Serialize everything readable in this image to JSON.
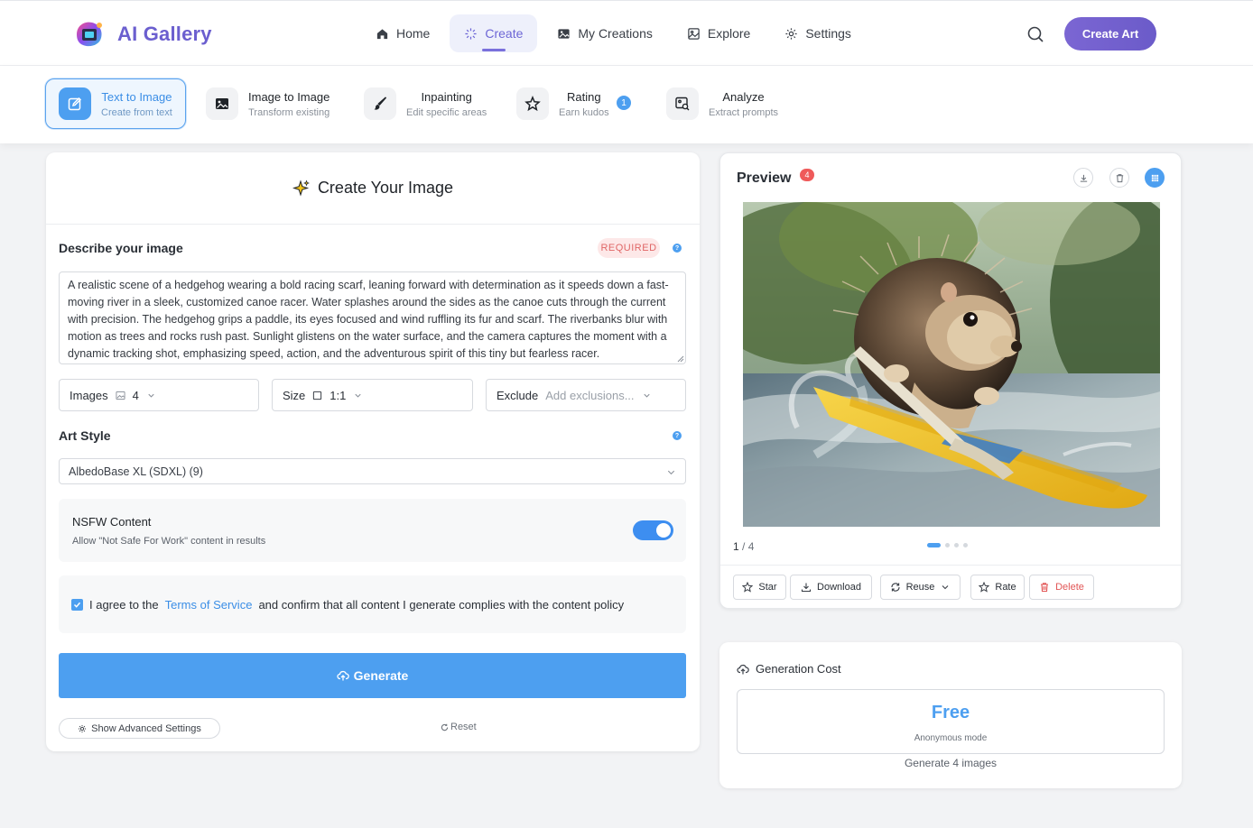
{
  "app": {
    "name": "AI Gallery"
  },
  "nav": {
    "items": [
      {
        "label": "Home",
        "icon": "home-icon"
      },
      {
        "label": "Create",
        "icon": "sparkle-icon",
        "active": true
      },
      {
        "label": "My Creations",
        "icon": "image-icon"
      },
      {
        "label": "Explore",
        "icon": "picture-icon"
      },
      {
        "label": "Settings",
        "icon": "gear-icon"
      }
    ],
    "cta": "Create Art"
  },
  "modes": [
    {
      "title": "Text to Image",
      "subtitle": "Create from text",
      "active": true
    },
    {
      "title": "Image to Image",
      "subtitle": "Transform existing"
    },
    {
      "title": "Inpainting",
      "subtitle": "Edit specific areas"
    },
    {
      "title": "Rating",
      "subtitle": "Earn kudos",
      "badge": "1"
    },
    {
      "title": "Analyze",
      "subtitle": "Extract prompts"
    }
  ],
  "form": {
    "title": "Create Your Image",
    "prompt_label": "Describe your image",
    "required": "REQUIRED",
    "prompt": "A realistic scene of a hedgehog wearing a bold racing scarf, leaning forward with determination as it speeds down a fast-moving river in a sleek, customized canoe racer. Water splashes around the sides as the canoe cuts through the current with precision. The hedgehog grips a paddle, its eyes focused and wind ruffling its fur and scarf. The riverbanks blur with motion as trees and rocks rush past. Sunlight glistens on the water surface, and the camera captures the moment with a dynamic tracking shot, emphasizing speed, action, and the adventurous spirit of this tiny but fearless racer.",
    "images_label": "Images",
    "images_value": "4",
    "size_label": "Size",
    "size_value": "1:1",
    "exclude_label": "Exclude",
    "exclude_placeholder": "Add exclusions...",
    "art_style_label": "Art Style",
    "art_style_value": "AlbedoBase XL (SDXL) (9)",
    "nsfw_title": "NSFW Content",
    "nsfw_desc": "Allow \"Not Safe For Work\" content in results",
    "nsfw_enabled": true,
    "agree_prefix": "I agree to the",
    "agree_link": "Terms of Service",
    "agree_suffix": "and confirm that all content I generate complies with the content policy",
    "agree_checked": true,
    "generate": "Generate",
    "advanced": "Show Advanced Settings",
    "reset": "Reset"
  },
  "preview": {
    "title": "Preview",
    "count": "4",
    "page_current": "1",
    "page_total": "/ 4",
    "actions": [
      "Star",
      "Download",
      "Reuse",
      "Rate",
      "Delete"
    ]
  },
  "cost": {
    "title": "Generation Cost",
    "value": "Free",
    "mode": "Anonymous mode",
    "note": "Generate 4 images"
  },
  "colors": {
    "accent": "#4d9ff0",
    "brand": "#6b5fcf",
    "danger": "#e25656"
  }
}
